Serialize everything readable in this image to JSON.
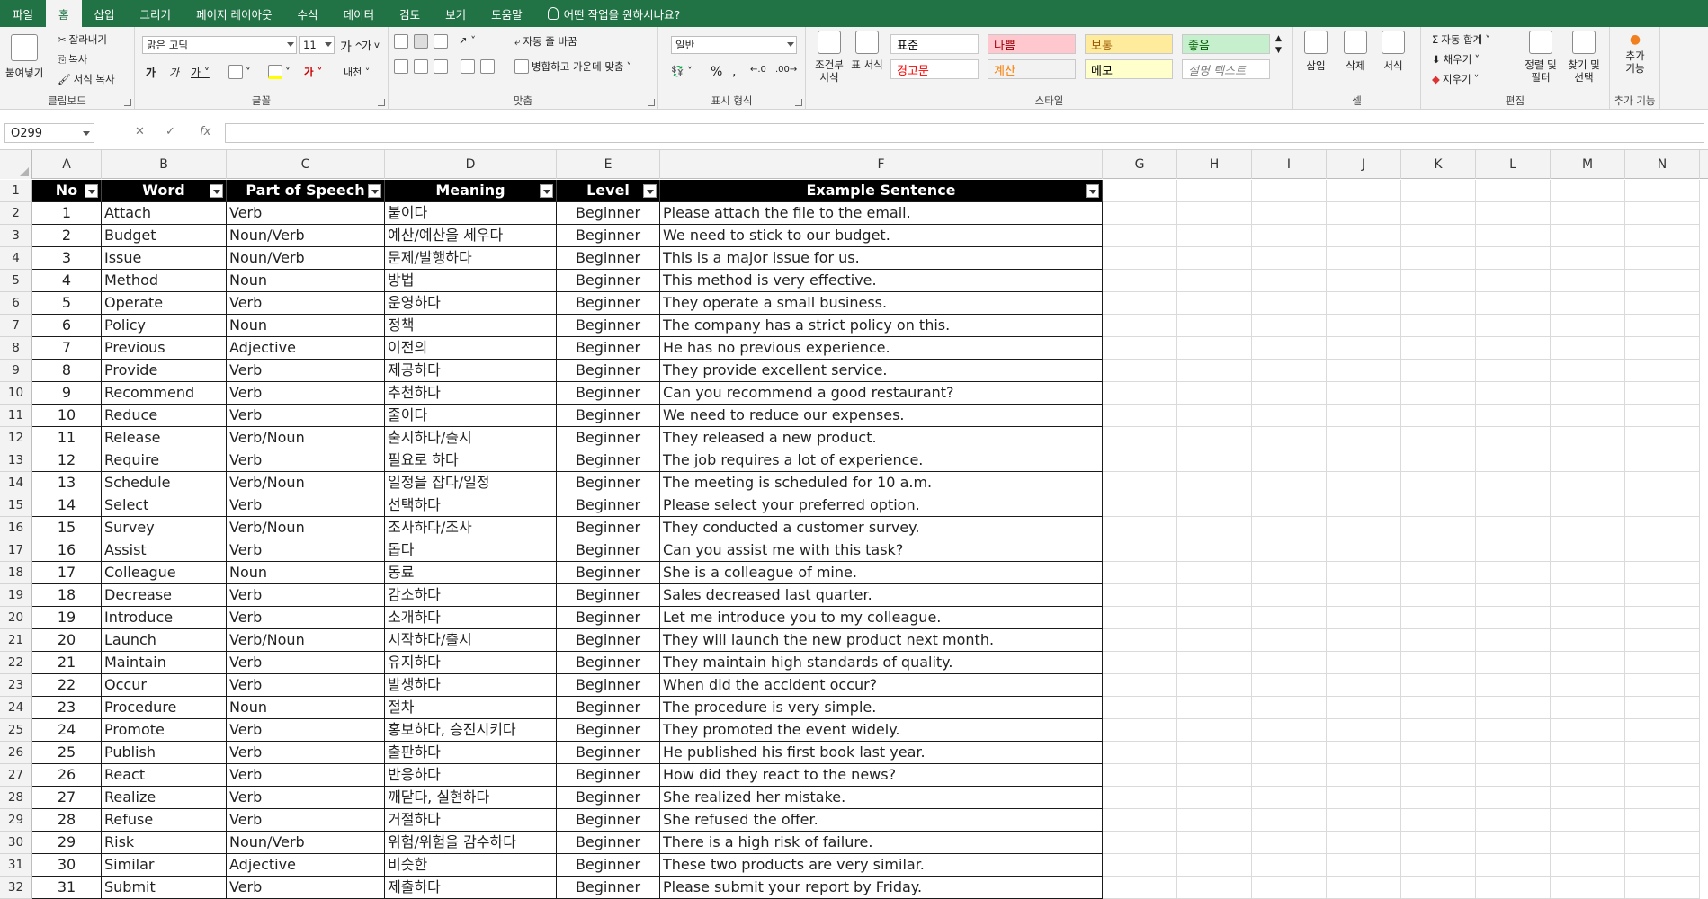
{
  "menu": {
    "tabs": [
      "파일",
      "홈",
      "삽입",
      "그리기",
      "페이지 레이아웃",
      "수식",
      "데이터",
      "검토",
      "보기",
      "도움말"
    ],
    "active_tab": "홈",
    "tell_me": "어떤 작업을 원하시나요?"
  },
  "ribbon": {
    "clipboard": {
      "paste": "붙여넣기",
      "cut": "잘라내기",
      "copy": "복사",
      "format_painter": "서식 복사",
      "label": "클립보드"
    },
    "font": {
      "font_name": "맑은 고딕",
      "font_size": "11",
      "label": "글꼴"
    },
    "alignment": {
      "wrap_text": "자동 줄 바꿈",
      "merge_center": "병합하고 가운데 맞춤",
      "label": "맞춤"
    },
    "number": {
      "format": "일반",
      "label": "표시 형식"
    },
    "styles": {
      "conditional_formatting": "조건부 서식",
      "format_as_table": "표 서식",
      "cells": [
        {
          "text": "표준",
          "bg": "#ffffff",
          "fg": "#000000"
        },
        {
          "text": "나쁨",
          "bg": "#ffc7ce",
          "fg": "#9c0006"
        },
        {
          "text": "보통",
          "bg": "#ffeb9c",
          "fg": "#9c5700"
        },
        {
          "text": "좋음",
          "bg": "#c6efce",
          "fg": "#006100"
        },
        {
          "text": "경고문",
          "bg": "#ffffff",
          "fg": "#ff0000"
        },
        {
          "text": "계산",
          "bg": "#f2f2f2",
          "fg": "#fa7d00"
        },
        {
          "text": "메모",
          "bg": "#ffffcc",
          "fg": "#000000"
        },
        {
          "text": "설명 텍스트",
          "bg": "#ffffff",
          "fg": "#7f7f7f"
        }
      ],
      "label": "스타일"
    },
    "cells_group": {
      "insert": "삽입",
      "delete": "삭제",
      "format": "서식",
      "label": "셀"
    },
    "editing": {
      "autosum": "자동 합계",
      "fill": "채우기",
      "clear": "지우기",
      "sort_filter": "정렬 및 필터",
      "find_select": "찾기 및 선택",
      "label": "편집"
    },
    "addins": {
      "addins": "추가 기능",
      "label": "추가 기능"
    }
  },
  "formula_bar": {
    "name_box": "O299",
    "fx": "fx",
    "value": ""
  },
  "columns": [
    "A",
    "B",
    "C",
    "D",
    "E",
    "F",
    "G",
    "H",
    "I",
    "J",
    "K",
    "L",
    "M",
    "N"
  ],
  "table": {
    "headers": [
      "No",
      "Word",
      "Part of Speech",
      "Meaning",
      "Level",
      "Example Sentence"
    ],
    "rows": [
      [
        "1",
        "Attach",
        "Verb",
        "붙이다",
        "Beginner",
        "Please attach the file to the email."
      ],
      [
        "2",
        "Budget",
        "Noun/Verb",
        "예산/예산을 세우다",
        "Beginner",
        "We need to stick to our budget."
      ],
      [
        "3",
        "Issue",
        "Noun/Verb",
        "문제/발행하다",
        "Beginner",
        "This is a major issue for us."
      ],
      [
        "4",
        "Method",
        "Noun",
        "방법",
        "Beginner",
        "This method is very effective."
      ],
      [
        "5",
        "Operate",
        "Verb",
        "운영하다",
        "Beginner",
        "They operate a small business."
      ],
      [
        "6",
        "Policy",
        "Noun",
        "정책",
        "Beginner",
        "The company has a strict policy on this."
      ],
      [
        "7",
        "Previous",
        "Adjective",
        "이전의",
        "Beginner",
        "He has no previous experience."
      ],
      [
        "8",
        "Provide",
        "Verb",
        "제공하다",
        "Beginner",
        "They provide excellent service."
      ],
      [
        "9",
        "Recommend",
        "Verb",
        "추천하다",
        "Beginner",
        "Can you recommend a good restaurant?"
      ],
      [
        "10",
        "Reduce",
        "Verb",
        "줄이다",
        "Beginner",
        "We need to reduce our expenses."
      ],
      [
        "11",
        "Release",
        "Verb/Noun",
        "출시하다/출시",
        "Beginner",
        "They released a new product."
      ],
      [
        "12",
        "Require",
        "Verb",
        "필요로 하다",
        "Beginner",
        "The job requires a lot of experience."
      ],
      [
        "13",
        "Schedule",
        "Verb/Noun",
        "일정을 잡다/일정",
        "Beginner",
        "The meeting is scheduled for 10 a.m."
      ],
      [
        "14",
        "Select",
        "Verb",
        "선택하다",
        "Beginner",
        "Please select your preferred option."
      ],
      [
        "15",
        "Survey",
        "Verb/Noun",
        "조사하다/조사",
        "Beginner",
        "They conducted a customer survey."
      ],
      [
        "16",
        "Assist",
        "Verb",
        "돕다",
        "Beginner",
        "Can you assist me with this task?"
      ],
      [
        "17",
        "Colleague",
        "Noun",
        "동료",
        "Beginner",
        "She is a colleague of mine."
      ],
      [
        "18",
        "Decrease",
        "Verb",
        "감소하다",
        "Beginner",
        "Sales decreased last quarter."
      ],
      [
        "19",
        "Introduce",
        "Verb",
        "소개하다",
        "Beginner",
        "Let me introduce you to my colleague."
      ],
      [
        "20",
        "Launch",
        "Verb/Noun",
        "시작하다/출시",
        "Beginner",
        "They will launch the new product next month."
      ],
      [
        "21",
        "Maintain",
        "Verb",
        "유지하다",
        "Beginner",
        "They maintain high standards of quality."
      ],
      [
        "22",
        "Occur",
        "Verb",
        "발생하다",
        "Beginner",
        "When did the accident occur?"
      ],
      [
        "23",
        "Procedure",
        "Noun",
        "절차",
        "Beginner",
        "The procedure is very simple."
      ],
      [
        "24",
        "Promote",
        "Verb",
        "홍보하다, 승진시키다",
        "Beginner",
        "They promoted the event widely."
      ],
      [
        "25",
        "Publish",
        "Verb",
        "출판하다",
        "Beginner",
        "He published his first book last year."
      ],
      [
        "26",
        "React",
        "Verb",
        "반응하다",
        "Beginner",
        "How did they react to the news?"
      ],
      [
        "27",
        "Realize",
        "Verb",
        "깨닫다, 실현하다",
        "Beginner",
        "She realized her mistake."
      ],
      [
        "28",
        "Refuse",
        "Verb",
        "거절하다",
        "Beginner",
        "She refused the offer."
      ],
      [
        "29",
        "Risk",
        "Noun/Verb",
        "위험/위험을 감수하다",
        "Beginner",
        "There is a high risk of failure."
      ],
      [
        "30",
        "Similar",
        "Adjective",
        "비슷한",
        "Beginner",
        "These two products are very similar."
      ],
      [
        "31",
        "Submit",
        "Verb",
        "제출하다",
        "Beginner",
        "Please submit your report by Friday."
      ]
    ]
  },
  "colors": {
    "accent": "#217346",
    "header_fill": "#000000",
    "header_text": "#ffffff"
  }
}
